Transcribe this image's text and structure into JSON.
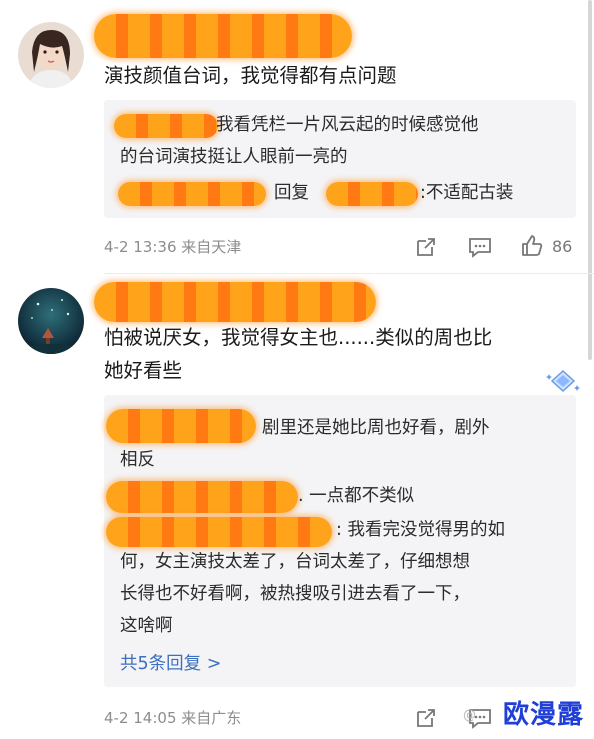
{
  "comment1": {
    "text": "演技颜值台词，我觉得都有点问题",
    "replies": {
      "line1": "我看凭栏一片风云起的时候感觉他",
      "line2": "的台词演技挺让人眼前一亮的",
      "line3_prefix": "回复",
      "line3_suffix": ":不适配古装"
    },
    "meta": "4-2 13:36 来自天津",
    "like_count": "86"
  },
  "comment2": {
    "text_line1": "怕被说厌女，我觉得女主也......类似的周也比",
    "text_line2": "她好看些",
    "replies": {
      "r1_line1": "剧里还是她比周也好看，剧外",
      "r1_line2": "相反",
      "r2": ". 一点都不类似",
      "r3_line1": ": 我看完没觉得男的如",
      "r3_line2": "何，女主演技太差了，台词太差了，仔细想想",
      "r3_line3": "长得也不好看啊，被热搜吸引进去看了一下，",
      "r3_line4": "这啥啊"
    },
    "more_replies": "共5条回复 >",
    "meta": "4-2 14:05 来自广东"
  },
  "watermark": {
    "brand": "欧漫露",
    "small": "@"
  },
  "icons": [
    "share-icon",
    "comment-icon",
    "like-icon",
    "diamond-badge-icon"
  ],
  "colors": {
    "redact": "#ff8c1a",
    "link": "#3b6fbf",
    "watermark": "#1f3fd6"
  }
}
